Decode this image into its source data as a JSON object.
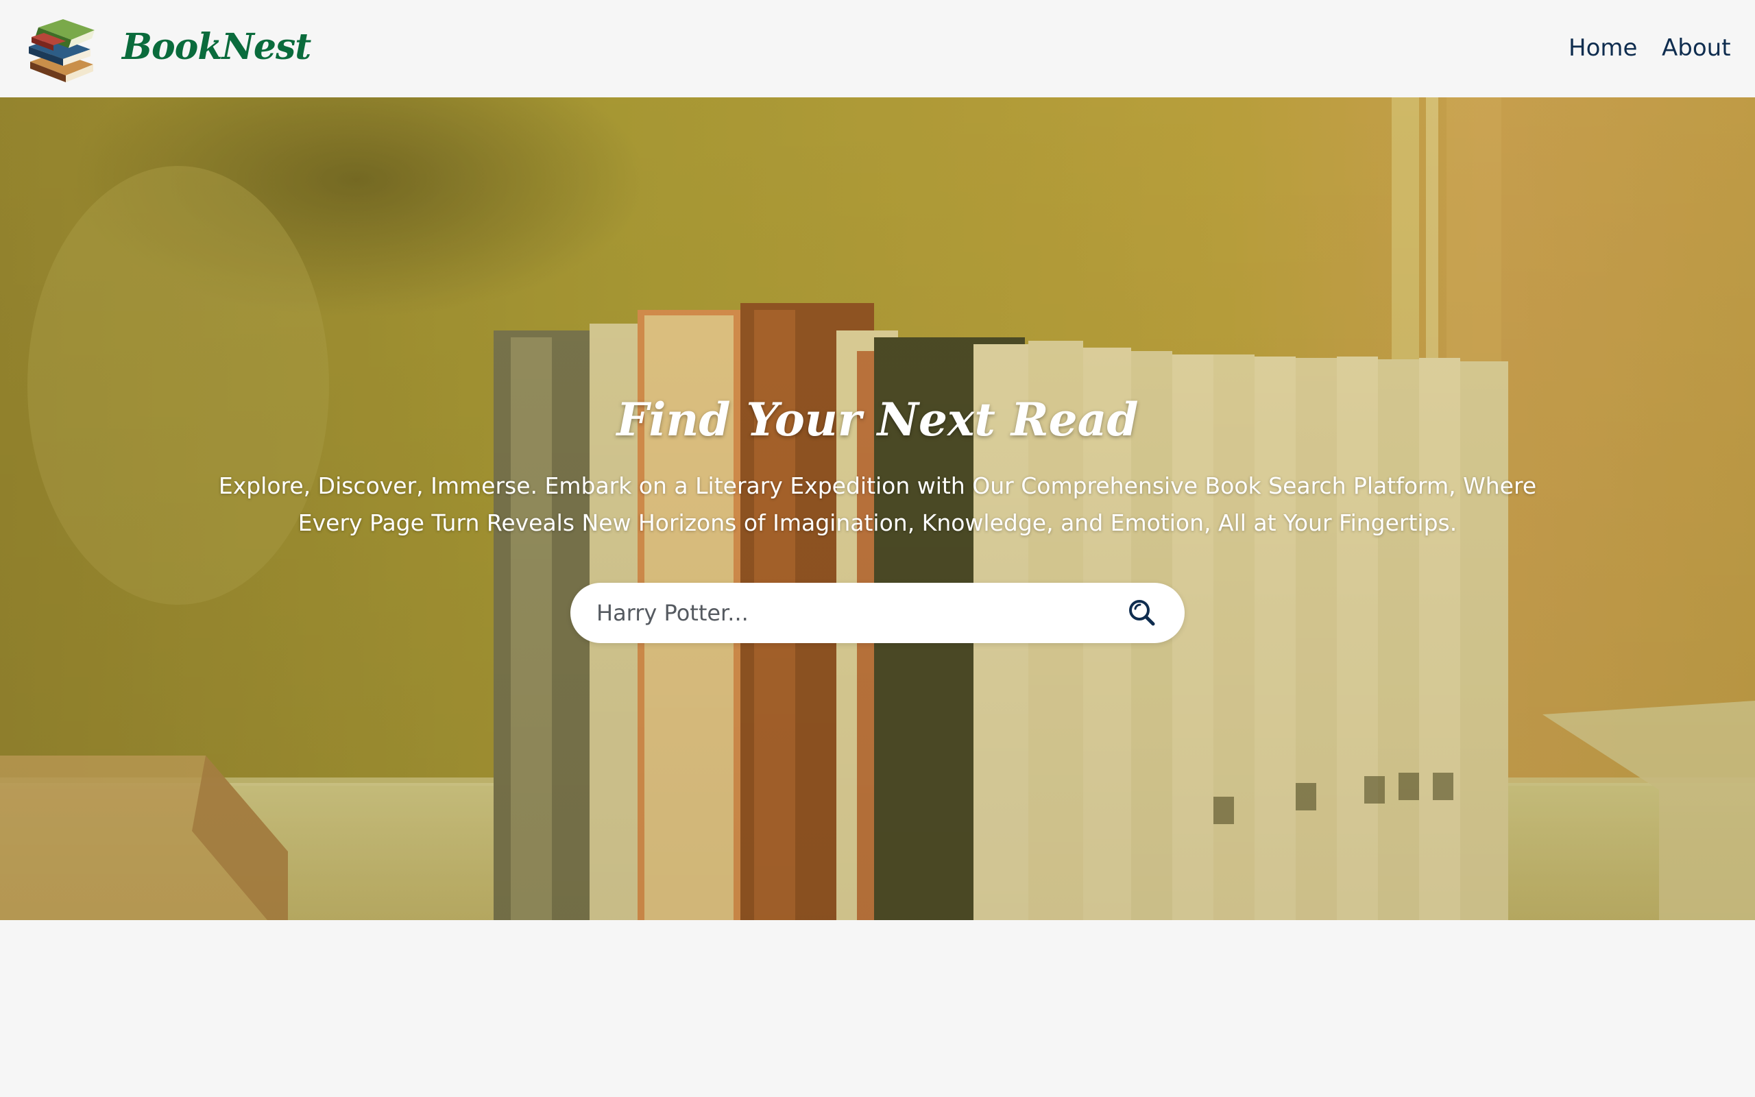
{
  "colors": {
    "brand_green": "#0a6b3c",
    "nav_text": "#0f2d4f",
    "page_background": "#f6f6f6",
    "hero_text": "#ffffff",
    "search_icon": "#0f2d4f"
  },
  "navbar": {
    "logo_icon": "books-stack-icon",
    "brand": "BookNest",
    "links": [
      {
        "label": "Home"
      },
      {
        "label": "About"
      }
    ]
  },
  "hero": {
    "background": "bookshelf-photo",
    "title": "Find Your Next Read",
    "subtitle": "Explore, Discover, Immerse. Embark on a Literary Expedition with Our Comprehensive Book Search Platform, Where Every Page Turn Reveals New Horizons of Imagination, Knowledge, and Emotion, All at Your Fingertips.",
    "search": {
      "placeholder": "Harry Potter...",
      "value": "",
      "button_icon": "search-icon"
    }
  }
}
